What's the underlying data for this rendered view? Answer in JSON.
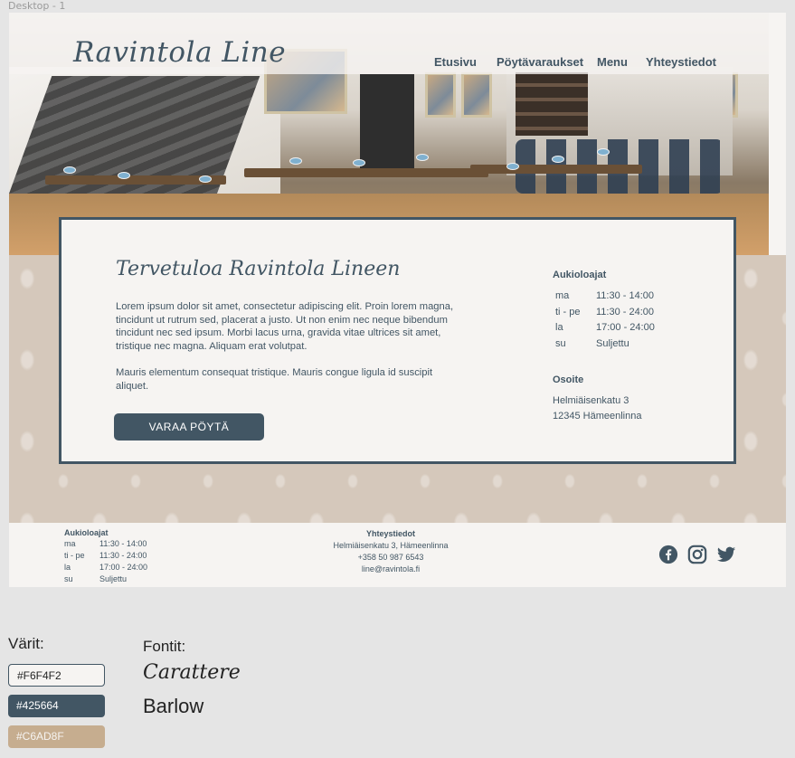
{
  "frame_label": "Desktop - 1",
  "header": {
    "logo": "Ravintola Line",
    "nav": [
      "Etusivu",
      "Pöytävaraukset",
      "Menu",
      "Yhteystiedot"
    ]
  },
  "main": {
    "welcome": "Tervetuloa Ravintola Lineen",
    "paragraph1": "Lorem ipsum dolor sit amet, consectetur adipiscing elit. Proin lorem magna, tincidunt ut rutrum sed, placerat a justo. Ut non enim nec neque bibendum tincidunt nec sed ipsum. Morbi lacus urna, gravida vitae ultrices sit amet, tristique nec magna. Aliquam erat volutpat.",
    "paragraph2": "Mauris elementum consequat tristique. Mauris congue ligula id suscipit aliquet.",
    "cta": "VARAA PÖYTÄ",
    "hours_title": "Aukioloajat",
    "hours": [
      {
        "day": "ma",
        "time": "11:30 - 14:00"
      },
      {
        "day": "ti - pe",
        "time": "11:30 - 24:00"
      },
      {
        "day": "la",
        "time": "17:00 - 24:00"
      },
      {
        "day": "su",
        "time": "Suljettu"
      }
    ],
    "address_title": "Osoite",
    "address_line1": "Helmiäisenkatu 3",
    "address_line2": "12345 Hämeenlinna"
  },
  "footer": {
    "hours_title": "Aukioloajat",
    "hours": [
      {
        "day": "ma",
        "time": "11:30 - 14:00"
      },
      {
        "day": "ti - pe",
        "time": "11:30 - 24:00"
      },
      {
        "day": "la",
        "time": "17:00 - 24:00"
      },
      {
        "day": "su",
        "time": "Suljettu"
      }
    ],
    "contact_title": "Yhteystiedot",
    "contact_address": "Helmiäisenkatu 3, Hämeenlinna",
    "contact_phone": "+358 50 987 6543",
    "contact_email": "line@ravintola.fi",
    "social_icons": [
      "facebook-icon",
      "instagram-icon",
      "twitter-icon"
    ]
  },
  "style_guide": {
    "colors_label": "Värit:",
    "colors": [
      "#F6F4F2",
      "#425664",
      "#C6AD8F"
    ],
    "fonts_label": "Fontit:",
    "fonts": [
      "Carattere",
      "Barlow"
    ]
  }
}
